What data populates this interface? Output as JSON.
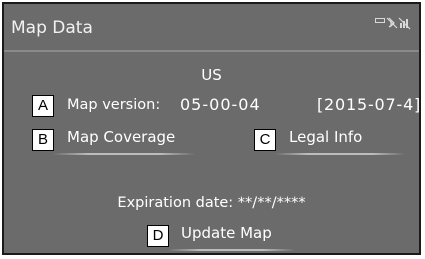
{
  "header": {
    "title": "Map Data",
    "status_icons": [
      "cellular-signal-icon",
      "bluetooth-off-icon",
      "signal-bars-icon"
    ]
  },
  "region": "US",
  "map_version": {
    "badge": "A",
    "label": "Map version:",
    "version": "05-00-04",
    "date": "[2015-07-4]"
  },
  "buttons": {
    "coverage": {
      "badge": "B",
      "label": "Map Coverage"
    },
    "legal": {
      "badge": "C",
      "label": "Legal Info"
    },
    "update": {
      "badge": "D",
      "label": "Update Map"
    }
  },
  "expiration": "Expiration date: **/**/****",
  "colors": {
    "screen_bg": "#6b6b6b",
    "text": "#ffffff",
    "divider": "#8a8a8a"
  }
}
